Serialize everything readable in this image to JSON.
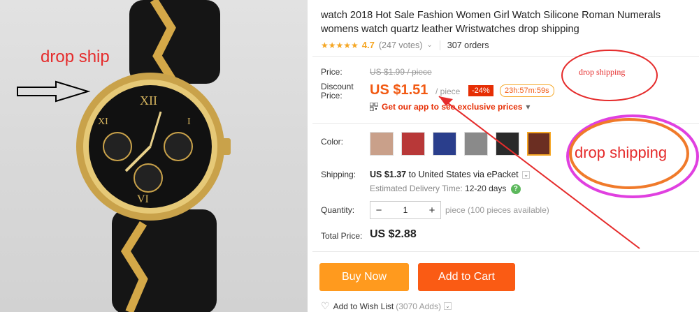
{
  "photo": {
    "label": "drop ship"
  },
  "product": {
    "title": "watch 2018 Hot Sale Fashion Women Girl Watch Silicone Roman Numerals womens watch quartz leather Wristwatches drop shipping",
    "stars": "★★★★★",
    "rating": "4.7",
    "votes": "(247 votes)",
    "orders": "307 orders"
  },
  "price": {
    "label": "Price:",
    "original": "US $1.99 / piece",
    "discount_label": "Discount Price:",
    "discount": "US $1.51",
    "per_piece": "/ piece",
    "off": "-24%",
    "timer": "23h:57m:59s",
    "app_promo": "Get our app to see exclusive prices",
    "app_chevron": "▾"
  },
  "color": {
    "label": "Color:",
    "swatches": [
      "brown",
      "red",
      "blue",
      "gray",
      "black",
      "box"
    ],
    "selected_index": 5
  },
  "shipping": {
    "label": "Shipping:",
    "cost": "US $1.37",
    "to": "to United States via ePacket",
    "estimate_label": "Estimated Delivery Time:",
    "estimate_days": "12-20 days"
  },
  "quantity": {
    "label": "Quantity:",
    "value": "1",
    "minus": "−",
    "plus": "+",
    "available": "piece (100 pieces available)"
  },
  "total": {
    "label": "Total Price:",
    "value": "US $2.88"
  },
  "buttons": {
    "buy_now": "Buy Now",
    "add_to_cart": "Add to Cart"
  },
  "wishlist": {
    "label": "Add to Wish List",
    "count": "(3070 Adds)"
  },
  "annotations": {
    "small": "drop shipping",
    "large": "drop shipping"
  },
  "colors": {
    "accent": "#f25a13",
    "buy": "#ff9a1e",
    "cart": "#fa5b14",
    "annot_red": "#e52b2b",
    "annot_magenta": "#e040e0",
    "annot_orange": "#f07a2a"
  }
}
